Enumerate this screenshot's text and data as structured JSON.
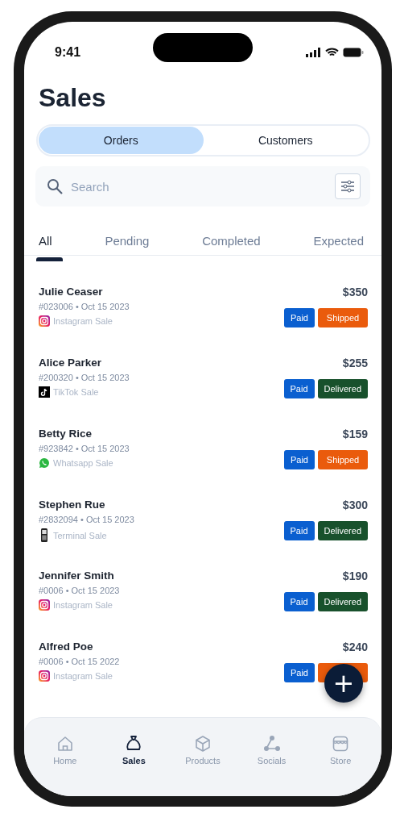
{
  "status_bar": {
    "time": "9:41"
  },
  "title": "Sales",
  "segments": [
    {
      "label": "Orders",
      "selected": true
    },
    {
      "label": "Customers",
      "selected": false
    }
  ],
  "search": {
    "placeholder": "Search"
  },
  "tabs": [
    {
      "label": "All",
      "selected": true
    },
    {
      "label": "Pending",
      "selected": false
    },
    {
      "label": "Completed",
      "selected": false
    },
    {
      "label": "Expected",
      "selected": false
    }
  ],
  "orders": [
    {
      "name": "Julie Ceaser",
      "meta": "#023006 • Oct 15 2023",
      "source": {
        "kind": "instagram",
        "label": "Instagram Sale"
      },
      "amount": "$350",
      "badges": [
        {
          "kind": "paid",
          "label": "Paid"
        },
        {
          "kind": "shipped",
          "label": "Shipped"
        }
      ]
    },
    {
      "name": "Alice Parker",
      "meta": "#200320 • Oct 15 2023",
      "source": {
        "kind": "tiktok",
        "label": "TikTok Sale"
      },
      "amount": "$255",
      "badges": [
        {
          "kind": "paid",
          "label": "Paid"
        },
        {
          "kind": "delivered",
          "label": "Delivered"
        }
      ]
    },
    {
      "name": "Betty Rice",
      "meta": "#923842 • Oct 15 2023",
      "source": {
        "kind": "whatsapp",
        "label": "Whatsapp Sale"
      },
      "amount": "$159",
      "badges": [
        {
          "kind": "paid",
          "label": "Paid"
        },
        {
          "kind": "shipped",
          "label": "Shipped"
        }
      ]
    },
    {
      "name": "Stephen Rue",
      "meta": "#2832094 • Oct 15 2023",
      "source": {
        "kind": "terminal",
        "label": "Terminal Sale"
      },
      "amount": "$300",
      "badges": [
        {
          "kind": "paid",
          "label": "Paid"
        },
        {
          "kind": "delivered",
          "label": "Delivered"
        }
      ]
    },
    {
      "name": "Jennifer Smith",
      "meta": "#0006 • Oct 15 2023",
      "source": {
        "kind": "instagram",
        "label": "Instagram Sale"
      },
      "amount": "$190",
      "badges": [
        {
          "kind": "paid",
          "label": "Paid"
        },
        {
          "kind": "delivered",
          "label": "Delivered"
        }
      ]
    },
    {
      "name": "Alfred Poe",
      "meta": "#0006 • Oct 15 2022",
      "source": {
        "kind": "instagram",
        "label": "Instagram Sale"
      },
      "amount": "$240",
      "badges": [
        {
          "kind": "paid",
          "label": "Paid"
        },
        {
          "kind": "shipped"
        }
      ]
    }
  ],
  "fab": {
    "label": "+"
  },
  "nav": [
    {
      "kind": "home",
      "label": "Home",
      "selected": false
    },
    {
      "kind": "sales",
      "label": "Sales",
      "selected": true
    },
    {
      "kind": "products",
      "label": "Products",
      "selected": false
    },
    {
      "kind": "socials",
      "label": "Socials",
      "selected": false
    },
    {
      "kind": "store",
      "label": "Store",
      "selected": false
    }
  ]
}
